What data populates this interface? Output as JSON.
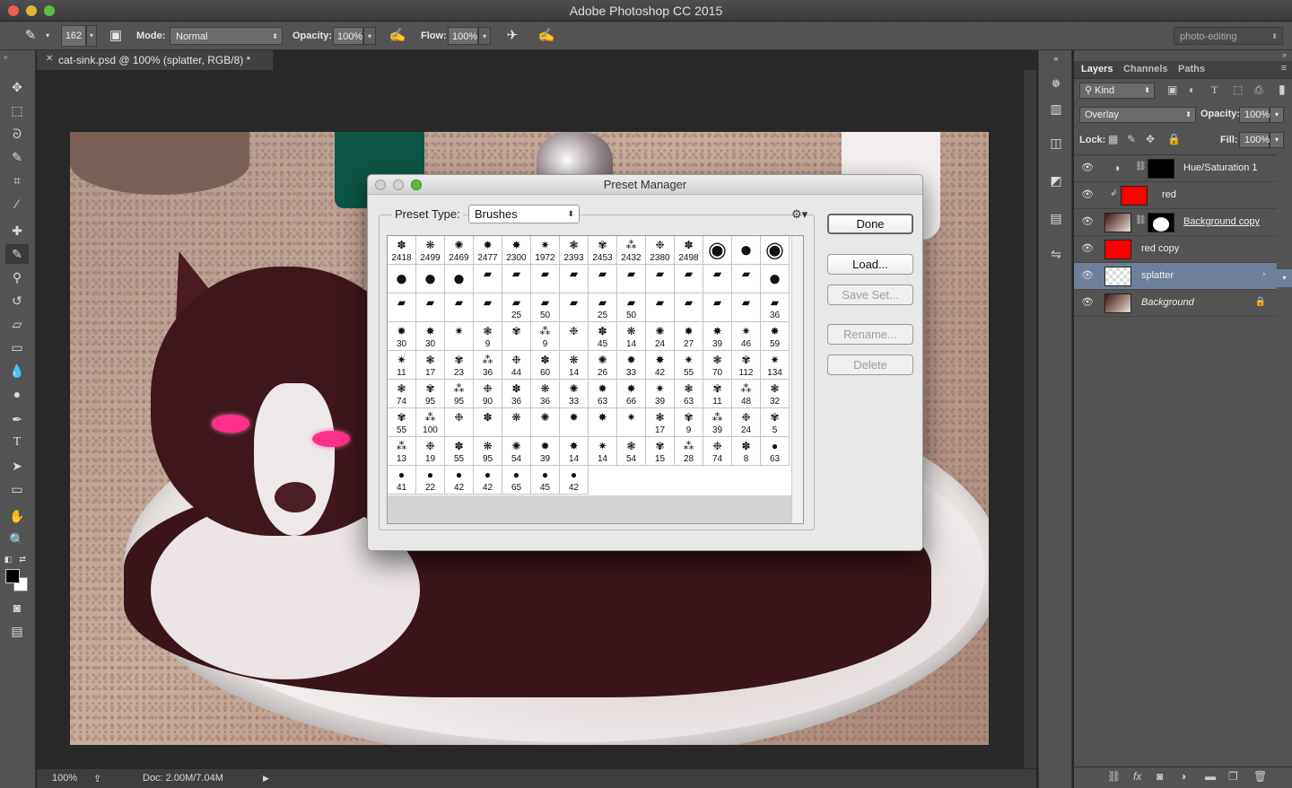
{
  "window": {
    "title": "Adobe Photoshop CC 2015"
  },
  "options_bar": {
    "brush_size": "162",
    "mode_label": "Mode:",
    "mode_value": "Normal",
    "opacity_label": "Opacity:",
    "opacity_value": "100%",
    "flow_label": "Flow:",
    "flow_value": "100%",
    "workspace": "photo-editing"
  },
  "document": {
    "tab_title": "cat-sink.psd @ 100% (splatter, RGB/8) *",
    "zoom": "100%",
    "doc_size": "Doc: 2.00M/7.04M"
  },
  "layers_panel": {
    "tabs": [
      "Layers",
      "Channels",
      "Paths"
    ],
    "filter_kind": "Kind",
    "blend_mode": "Overlay",
    "opacity_label": "Opacity:",
    "opacity_value": "100%",
    "lock_label": "Lock:",
    "fill_label": "Fill:",
    "fill_value": "100%",
    "layers": [
      {
        "name": "Hue/Saturation 1",
        "selected": false
      },
      {
        "name": "red",
        "selected": false
      },
      {
        "name": "Background copy",
        "selected": false
      },
      {
        "name": "red copy",
        "selected": false
      },
      {
        "name": "splatter",
        "selected": true
      },
      {
        "name": "Background",
        "selected": false
      }
    ]
  },
  "preset_manager": {
    "title": "Preset Manager",
    "preset_type_label": "Preset Type:",
    "preset_type_value": "Brushes",
    "buttons": {
      "done": "Done",
      "load": "Load...",
      "save_set": "Save Set...",
      "rename": "Rename...",
      "delete": "Delete"
    },
    "brushes": [
      [
        "2418",
        "2499",
        "2469",
        "2477",
        "2300",
        "1972",
        "2393",
        "2453",
        "2432",
        "2380",
        "2498",
        "",
        "",
        ""
      ],
      [
        "",
        "",
        "",
        "",
        "",
        "",
        "",
        "",
        "",
        "",
        "",
        "",
        "",
        ""
      ],
      [
        "",
        "",
        "",
        "",
        "25",
        "50",
        "",
        "25",
        "50",
        "",
        "",
        "",
        "",
        "36"
      ],
      [
        "30",
        "30",
        "",
        "9",
        "",
        "9",
        "",
        "45",
        "14",
        "24",
        "27",
        "39",
        "46"
      ],
      [
        "59",
        "11",
        "17",
        "23",
        "36",
        "44",
        "60",
        "14",
        "26",
        "33",
        "42",
        "55",
        "70",
        "112"
      ],
      [
        "134",
        "74",
        "95",
        "95",
        "90",
        "36",
        "36",
        "33",
        "63",
        "66",
        "39",
        "63",
        "11",
        "48"
      ],
      [
        "32",
        "55",
        "100",
        "",
        "",
        "",
        "",
        "",
        "",
        "",
        "17",
        "9",
        "39",
        "24"
      ],
      [
        "5",
        "13",
        "19",
        "55",
        "95",
        "54",
        "39",
        "14",
        "14",
        "54",
        "15",
        "28",
        "74",
        "8"
      ],
      [
        "63",
        "41",
        "22",
        "42",
        "42",
        "65",
        "45",
        "42"
      ]
    ]
  },
  "colors": {
    "selected_layer": "#6d7f9a",
    "red_fill": "#ff0000",
    "ui_dark": "#535353"
  }
}
